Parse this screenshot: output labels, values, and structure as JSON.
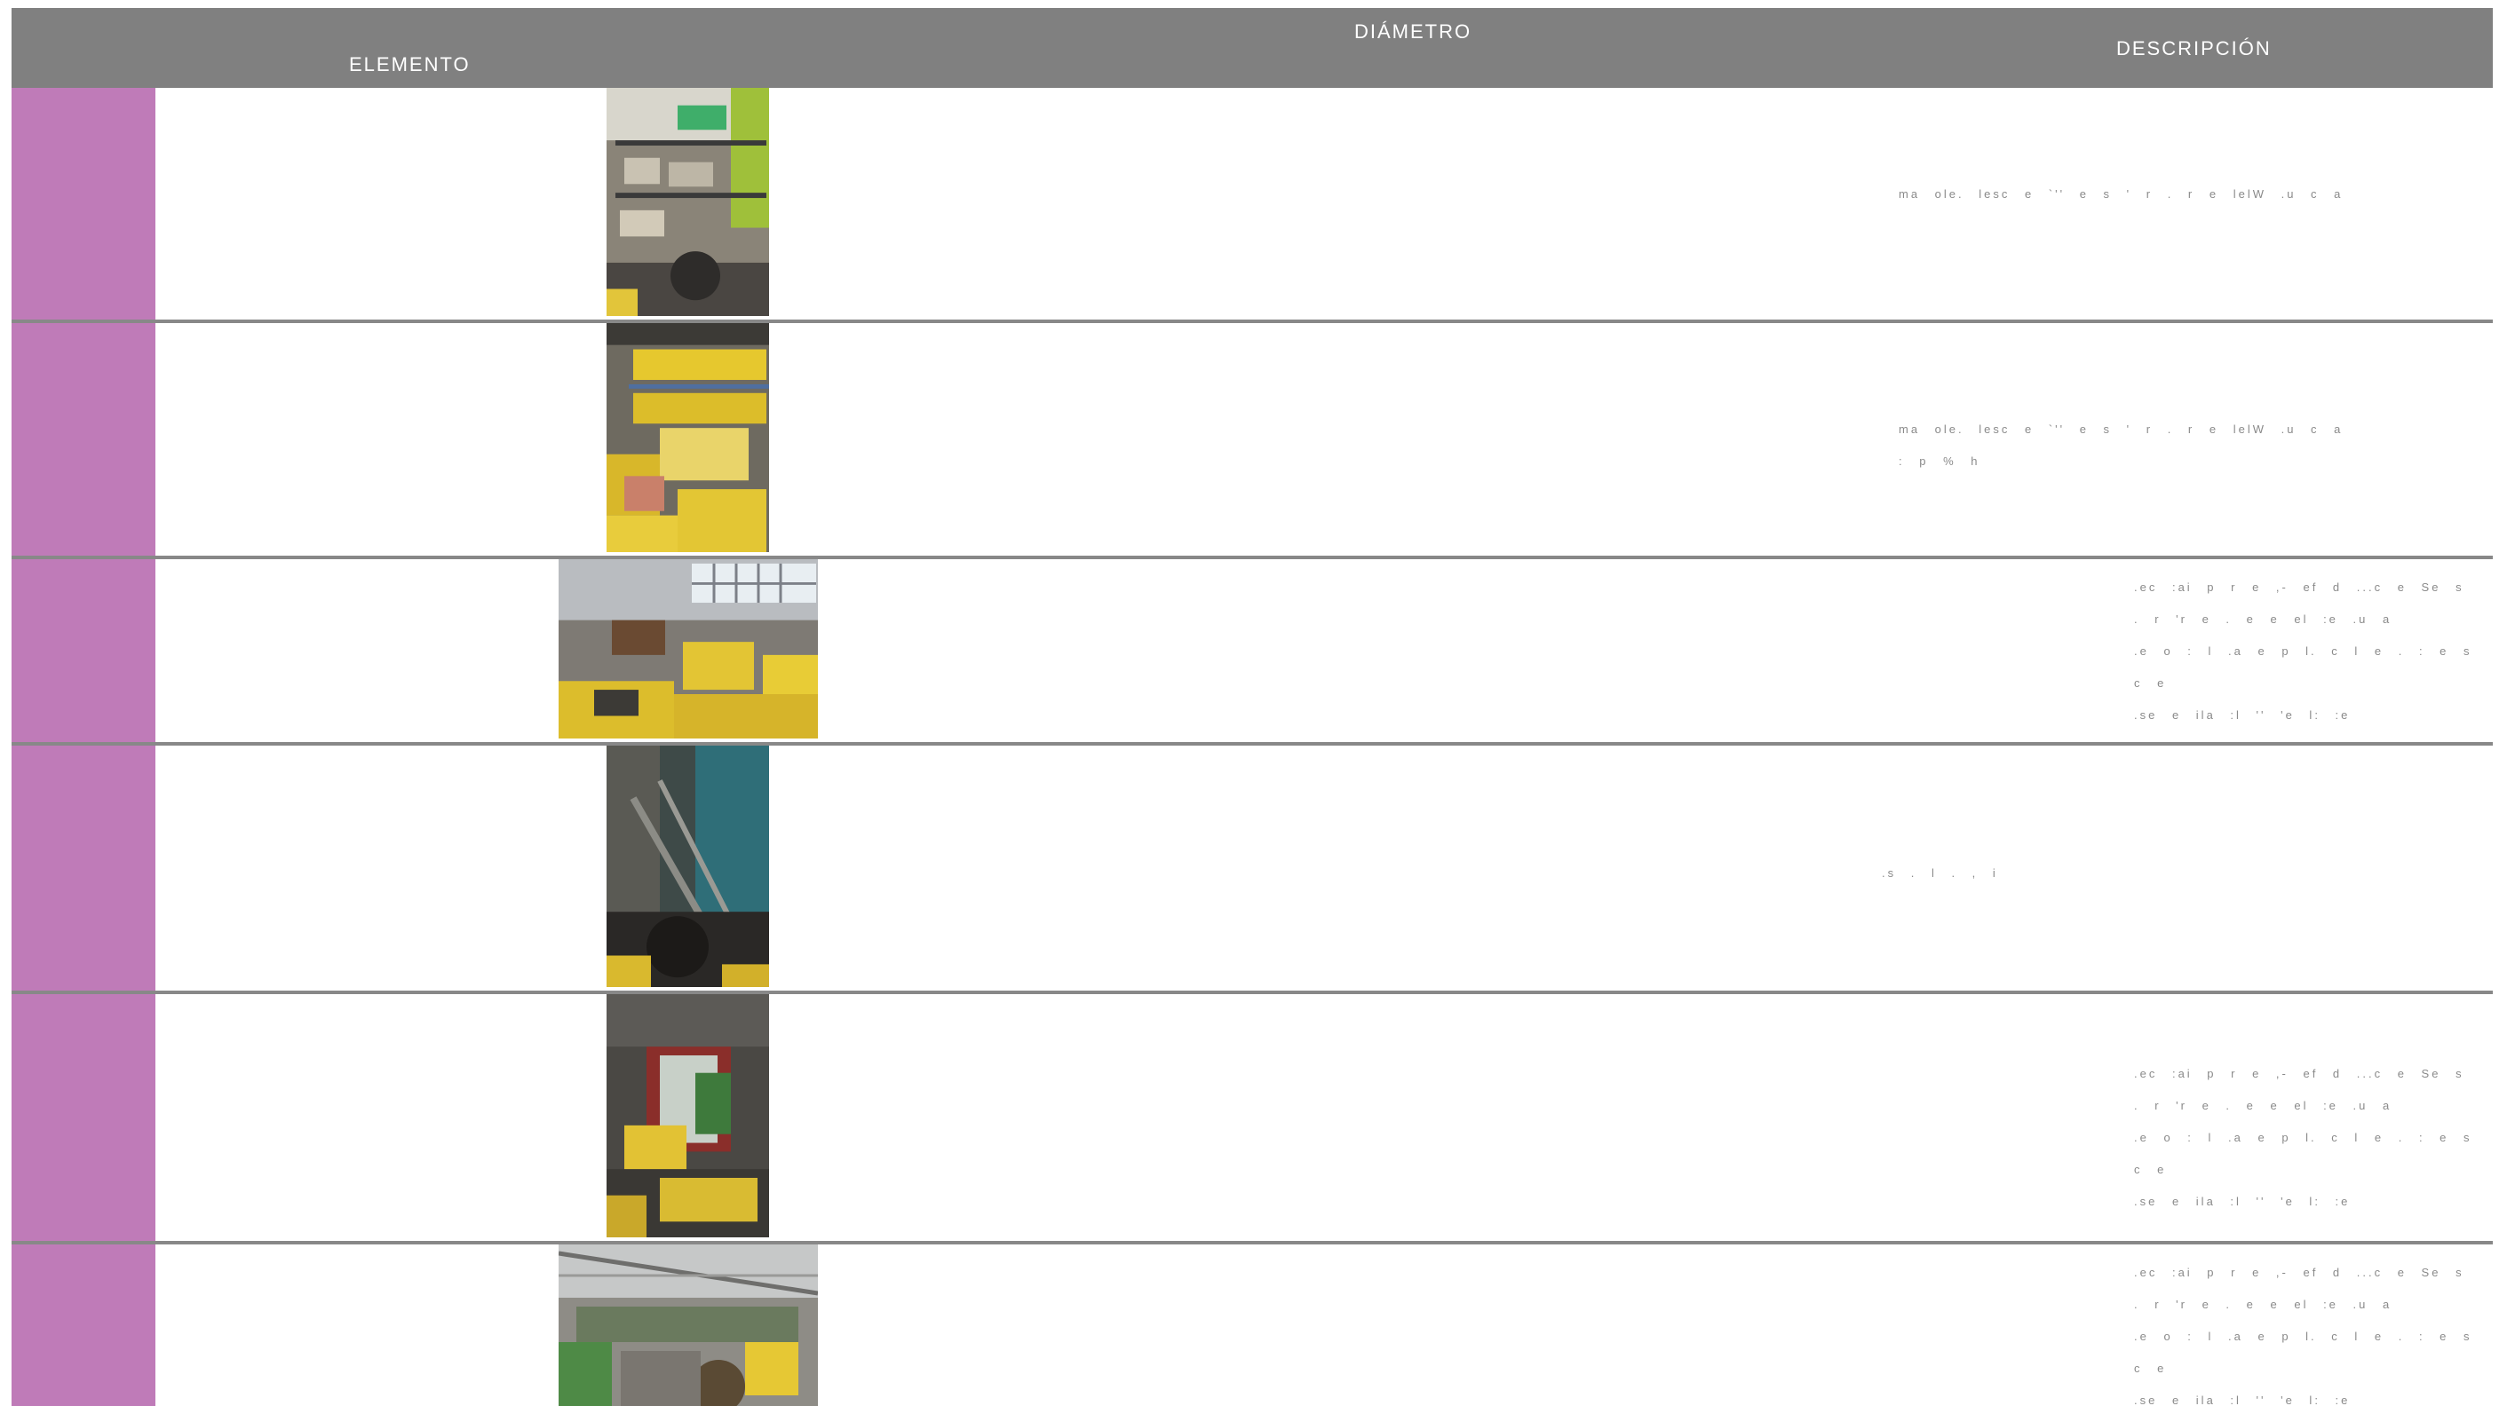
{
  "table": {
    "headers": {
      "elemento": "ELEMENTO",
      "diametro": "DIÁMETRO",
      "descripcion": "DESCRIPCIÓN"
    },
    "rows": [
      {
        "swatch_color": "#bf7bb8",
        "photo": "shelving-with-boxes-photo",
        "description": "ma    ole.  lesc     e      `'' e  s '  r  .   r  e  lelW    .u   c  a"
      },
      {
        "swatch_color": "#bf7bb8",
        "photo": "yellow-crates-shelf-photo",
        "description": "ma    ole.  lesc     e      `'' e  s '  r  .   r  e  lelW    .u   c  a\n: p %  h"
      },
      {
        "swatch_color": "#bf7bb8",
        "photo": "warehouse-crates-photo",
        "description": ".ec :ai  p    r    e     ,-  ef  d  ...c  e  Se  s\n. r    'r   e  . e  e  el  :e   .u   a\n.e o  : l   .a e  p    l.  c  l    e .  :   e  s  c  e\n.se  e    ila  :l    ''    'e  l:  :e"
      },
      {
        "swatch_color": "#bf7bb8",
        "photo": "corridor-debris-photo",
        "description": ".s     . l     .   ,   i"
      },
      {
        "swatch_color": "#bf7bb8",
        "photo": "doorway-cart-photo",
        "description": ".ec :ai  p    r    e     ,-  ef  d  ...c  e  Se  s\n. r    'r   e  . e  e  el  :e   .u   a\n.e o  : l   .a e  p    l.  c  l    e .  :   e  s  c  e\n.se  e    ila  :l    ''    'e  l:  :e"
      },
      {
        "swatch_color": "#bf7bb8",
        "photo": "workshop-hall-photo",
        "description": ".ec :ai  p    r    e     ,-  ef  d  ...c  e  Se  s\n. r    'r   e  . e  e  el  :e   .u   a\n.e o  : l   .a e  p    l.  c  l    e .  :   e  s  c  e\n.se  e    ila  :l    ''    'e  l:  :e"
      }
    ]
  }
}
